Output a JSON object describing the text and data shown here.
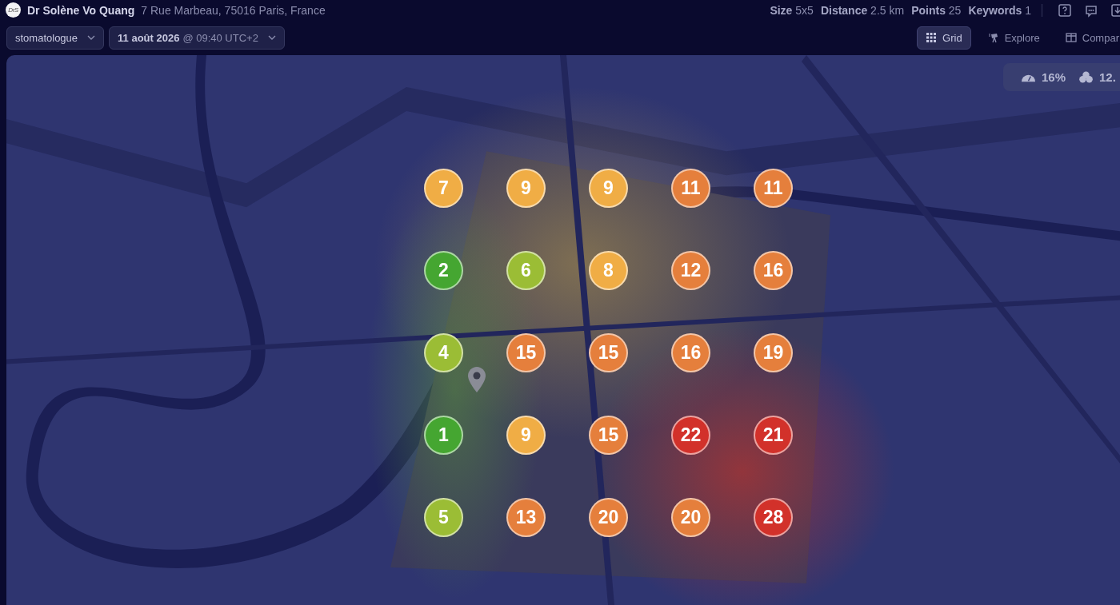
{
  "business": {
    "logo": "DrS",
    "name": "Dr Solène Vo Quang",
    "address": "7 Rue Marbeau, 75016 Paris, France"
  },
  "stats": [
    {
      "label": "Size",
      "value": "5x5"
    },
    {
      "label": "Distance",
      "value": "2.5 km"
    },
    {
      "label": "Points",
      "value": "25"
    },
    {
      "label": "Keywords",
      "value": "1"
    }
  ],
  "filters": [
    {
      "kind": "keyword",
      "label": "stomatologue"
    },
    {
      "kind": "date",
      "label": "11 août 2026",
      "detail": "@ 09:40 UTC+2"
    }
  ],
  "views": [
    {
      "kind": "grid",
      "label": "Grid",
      "selected": true
    },
    {
      "kind": "explore",
      "label": "Explore",
      "selected": false
    },
    {
      "kind": "compare",
      "label": "Compar",
      "selected": false
    }
  ],
  "map": {
    "metrics": [
      {
        "kind": "gauge",
        "value": "16%"
      },
      {
        "kind": "circles",
        "value": "12."
      }
    ],
    "grid": [
      [
        {
          "rank": "7",
          "color": "#f0ad45"
        },
        {
          "rank": "9",
          "color": "#f0ad45"
        },
        {
          "rank": "9",
          "color": "#f0ad45"
        },
        {
          "rank": "11",
          "color": "#e57f3c"
        },
        {
          "rank": "11",
          "color": "#e57f3c"
        }
      ],
      [
        {
          "rank": "2",
          "color": "#45a631"
        },
        {
          "rank": "6",
          "color": "#9bbd35"
        },
        {
          "rank": "8",
          "color": "#f0ad45"
        },
        {
          "rank": "12",
          "color": "#e57f3c"
        },
        {
          "rank": "16",
          "color": "#e57f3c"
        }
      ],
      [
        {
          "rank": "4",
          "color": "#9bbd35"
        },
        {
          "rank": "15",
          "color": "#e57f3c"
        },
        {
          "rank": "15",
          "color": "#e57f3c"
        },
        {
          "rank": "16",
          "color": "#e57f3c"
        },
        {
          "rank": "19",
          "color": "#e57f3c"
        }
      ],
      [
        {
          "rank": "1",
          "color": "#45a631"
        },
        {
          "rank": "9",
          "color": "#f0ad45"
        },
        {
          "rank": "15",
          "color": "#e57f3c"
        },
        {
          "rank": "22",
          "color": "#d2312a"
        },
        {
          "rank": "21",
          "color": "#d2312a"
        }
      ],
      [
        {
          "rank": "5",
          "color": "#9bbd35"
        },
        {
          "rank": "13",
          "color": "#e57f3c"
        },
        {
          "rank": "20",
          "color": "#e57f3c"
        },
        {
          "rank": "20",
          "color": "#e57f3c"
        },
        {
          "rank": "28",
          "color": "#d2312a"
        }
      ]
    ]
  }
}
